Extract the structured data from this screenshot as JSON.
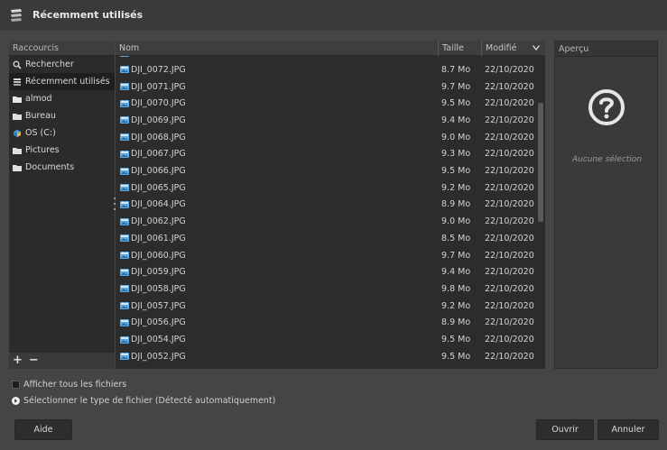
{
  "window": {
    "title": "Récemment utilisés",
    "icon": "recent-stack-icon"
  },
  "places": {
    "header": "Raccourcis",
    "items": [
      {
        "label": "Rechercher",
        "icon": "search-icon"
      },
      {
        "label": "Récemment utilisés",
        "icon": "recent-stack-icon"
      },
      {
        "label": "almod",
        "icon": "home-folder-icon"
      },
      {
        "label": "Bureau",
        "icon": "folder-icon"
      },
      {
        "label": "OS (C:)",
        "icon": "drive-icon"
      },
      {
        "label": "Pictures",
        "icon": "folder-icon"
      },
      {
        "label": "Documents",
        "icon": "folder-icon"
      }
    ],
    "selected_index": 1,
    "add_label": "+",
    "remove_label": "−"
  },
  "files": {
    "headers": {
      "name": "Nom",
      "size": "Taille",
      "modified": "Modifié"
    },
    "rows": [
      {
        "name": "DJI_0072.JPG",
        "size": "8.7 Mo",
        "modified": "22/10/2020"
      },
      {
        "name": "DJI_0071.JPG",
        "size": "9.7 Mo",
        "modified": "22/10/2020"
      },
      {
        "name": "DJI_0070.JPG",
        "size": "9.5 Mo",
        "modified": "22/10/2020"
      },
      {
        "name": "DJI_0069.JPG",
        "size": "9.4 Mo",
        "modified": "22/10/2020"
      },
      {
        "name": "DJI_0068.JPG",
        "size": "9.0 Mo",
        "modified": "22/10/2020"
      },
      {
        "name": "DJI_0067.JPG",
        "size": "9.3 Mo",
        "modified": "22/10/2020"
      },
      {
        "name": "DJI_0066.JPG",
        "size": "9.5 Mo",
        "modified": "22/10/2020"
      },
      {
        "name": "DJI_0065.JPG",
        "size": "9.2 Mo",
        "modified": "22/10/2020"
      },
      {
        "name": "DJI_0064.JPG",
        "size": "8.9 Mo",
        "modified": "22/10/2020"
      },
      {
        "name": "DJI_0062.JPG",
        "size": "9.0 Mo",
        "modified": "22/10/2020"
      },
      {
        "name": "DJI_0061.JPG",
        "size": "8.5 Mo",
        "modified": "22/10/2020"
      },
      {
        "name": "DJI_0060.JPG",
        "size": "9.7 Mo",
        "modified": "22/10/2020"
      },
      {
        "name": "DJI_0059.JPG",
        "size": "9.4 Mo",
        "modified": "22/10/2020"
      },
      {
        "name": "DJI_0058.JPG",
        "size": "9.8 Mo",
        "modified": "22/10/2020"
      },
      {
        "name": "DJI_0057.JPG",
        "size": "9.2 Mo",
        "modified": "22/10/2020"
      },
      {
        "name": "DJI_0056.JPG",
        "size": "8.9 Mo",
        "modified": "22/10/2020"
      },
      {
        "name": "DJI_0054.JPG",
        "size": "9.5 Mo",
        "modified": "22/10/2020"
      },
      {
        "name": "DJI_0052.JPG",
        "size": "9.5 Mo",
        "modified": "22/10/2020"
      }
    ]
  },
  "preview": {
    "header": "Aperçu",
    "empty_text": "Aucune sélection",
    "icon": "question-icon"
  },
  "options": {
    "show_all_files": "Afficher tous les fichiers",
    "show_all_checked": false,
    "file_type": "Sélectionner le type de fichier (Détecté automatiquement)"
  },
  "buttons": {
    "help": "Aide",
    "open": "Ouvrir",
    "cancel": "Annuler"
  },
  "colors": {
    "dialog_bg": "#454545",
    "list_bg": "#2c2c2c",
    "selected_place": "#1f1f1f",
    "file_icon": "#5fa8e0"
  }
}
